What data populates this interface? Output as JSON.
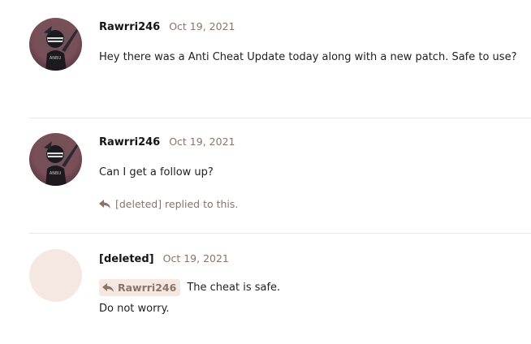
{
  "posts": [
    {
      "username": "Rawrri246",
      "date": "Oct 19, 2021",
      "message": "Hey there was a Anti Cheat Update today along with a new patch. Safe to use?",
      "avatar_text": "ANBU"
    },
    {
      "username": "Rawrri246",
      "date": "Oct 19, 2021",
      "message": "Can I get a follow up?",
      "avatar_text": "ANBU",
      "replied_note": "[deleted] replied to this."
    },
    {
      "username": "[deleted]",
      "date": "Oct 19, 2021",
      "quote_author": "Rawrri246",
      "message_line1": "The cheat is safe.",
      "message_line2": "Do not worry."
    }
  ],
  "colors": {
    "accent": "#8a7469",
    "quote_bg": "#f5e8e2",
    "divider": "#ebe6e3",
    "text": "#1f1f1f"
  },
  "icons": {
    "reply": "reply-arrow-icon"
  }
}
